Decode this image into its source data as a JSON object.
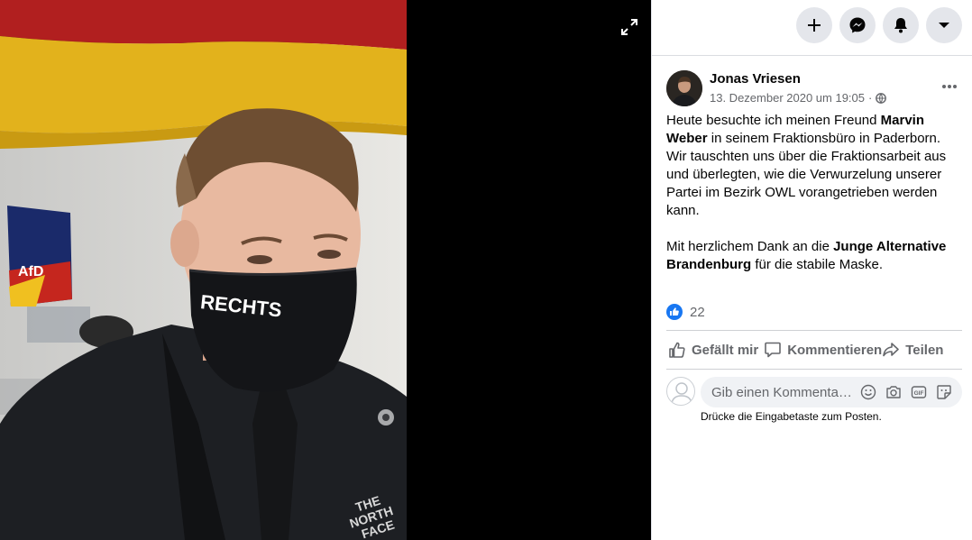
{
  "post": {
    "author": "Jonas Vriesen",
    "date": "13. Dezember 2020 um 19:05",
    "separator": "·",
    "paragraph1": {
      "part1": "Heute besuchte ich meinen Freund ",
      "bold1": "Marvin Weber",
      "part2": " in seinem Fraktionsbüro in Paderborn. Wir tauschten uns über die Fraktionsarbeit aus und überlegten, wie die Verwurzelung unserer Partei im Bezirk OWL vorangetrieben werden kann."
    },
    "paragraph2": {
      "part1": "Mit herzlichem Dank an die ",
      "bold1": "Junge Alternative Brandenburg",
      "part2": " für die stabile Maske."
    },
    "like_count": "22"
  },
  "actions": {
    "like": "Gefällt mir",
    "comment": "Kommentieren",
    "share": "Teilen"
  },
  "comment": {
    "placeholder": "Gib einen Kommenta…",
    "hint": "Drücke die Eingabetaste zum Posten."
  },
  "photo": {
    "mask_text": "RECHTS",
    "jacket_text": "THE NORTH FACE"
  },
  "colors": {
    "accent": "#1877f2",
    "secondary_text": "#65676b",
    "button_bg": "#e4e6eb",
    "viewer_bg": "#000000"
  },
  "icons": [
    "expand-icon",
    "plus-icon",
    "messenger-icon",
    "bell-icon",
    "caret-down-icon",
    "globe-icon",
    "more-icon",
    "thumbs-up-icon",
    "comment-icon",
    "share-icon",
    "emoji-icon",
    "camera-icon",
    "gif-icon",
    "sticker-icon"
  ]
}
